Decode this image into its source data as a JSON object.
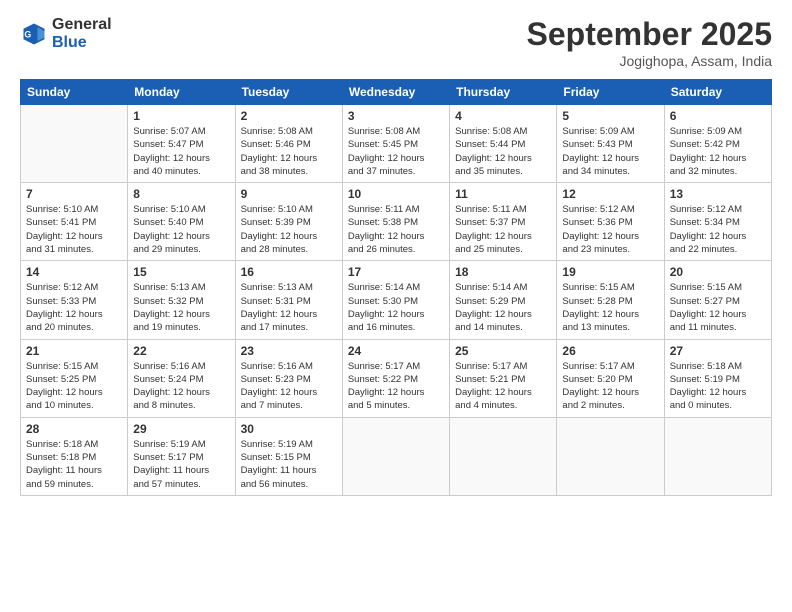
{
  "header": {
    "logo_line1": "General",
    "logo_line2": "Blue",
    "title": "September 2025",
    "location": "Jogighopa, Assam, India"
  },
  "days_of_week": [
    "Sunday",
    "Monday",
    "Tuesday",
    "Wednesday",
    "Thursday",
    "Friday",
    "Saturday"
  ],
  "weeks": [
    [
      {
        "day": "",
        "info": ""
      },
      {
        "day": "1",
        "info": "Sunrise: 5:07 AM\nSunset: 5:47 PM\nDaylight: 12 hours\nand 40 minutes."
      },
      {
        "day": "2",
        "info": "Sunrise: 5:08 AM\nSunset: 5:46 PM\nDaylight: 12 hours\nand 38 minutes."
      },
      {
        "day": "3",
        "info": "Sunrise: 5:08 AM\nSunset: 5:45 PM\nDaylight: 12 hours\nand 37 minutes."
      },
      {
        "day": "4",
        "info": "Sunrise: 5:08 AM\nSunset: 5:44 PM\nDaylight: 12 hours\nand 35 minutes."
      },
      {
        "day": "5",
        "info": "Sunrise: 5:09 AM\nSunset: 5:43 PM\nDaylight: 12 hours\nand 34 minutes."
      },
      {
        "day": "6",
        "info": "Sunrise: 5:09 AM\nSunset: 5:42 PM\nDaylight: 12 hours\nand 32 minutes."
      }
    ],
    [
      {
        "day": "7",
        "info": "Sunrise: 5:10 AM\nSunset: 5:41 PM\nDaylight: 12 hours\nand 31 minutes."
      },
      {
        "day": "8",
        "info": "Sunrise: 5:10 AM\nSunset: 5:40 PM\nDaylight: 12 hours\nand 29 minutes."
      },
      {
        "day": "9",
        "info": "Sunrise: 5:10 AM\nSunset: 5:39 PM\nDaylight: 12 hours\nand 28 minutes."
      },
      {
        "day": "10",
        "info": "Sunrise: 5:11 AM\nSunset: 5:38 PM\nDaylight: 12 hours\nand 26 minutes."
      },
      {
        "day": "11",
        "info": "Sunrise: 5:11 AM\nSunset: 5:37 PM\nDaylight: 12 hours\nand 25 minutes."
      },
      {
        "day": "12",
        "info": "Sunrise: 5:12 AM\nSunset: 5:36 PM\nDaylight: 12 hours\nand 23 minutes."
      },
      {
        "day": "13",
        "info": "Sunrise: 5:12 AM\nSunset: 5:34 PM\nDaylight: 12 hours\nand 22 minutes."
      }
    ],
    [
      {
        "day": "14",
        "info": "Sunrise: 5:12 AM\nSunset: 5:33 PM\nDaylight: 12 hours\nand 20 minutes."
      },
      {
        "day": "15",
        "info": "Sunrise: 5:13 AM\nSunset: 5:32 PM\nDaylight: 12 hours\nand 19 minutes."
      },
      {
        "day": "16",
        "info": "Sunrise: 5:13 AM\nSunset: 5:31 PM\nDaylight: 12 hours\nand 17 minutes."
      },
      {
        "day": "17",
        "info": "Sunrise: 5:14 AM\nSunset: 5:30 PM\nDaylight: 12 hours\nand 16 minutes."
      },
      {
        "day": "18",
        "info": "Sunrise: 5:14 AM\nSunset: 5:29 PM\nDaylight: 12 hours\nand 14 minutes."
      },
      {
        "day": "19",
        "info": "Sunrise: 5:15 AM\nSunset: 5:28 PM\nDaylight: 12 hours\nand 13 minutes."
      },
      {
        "day": "20",
        "info": "Sunrise: 5:15 AM\nSunset: 5:27 PM\nDaylight: 12 hours\nand 11 minutes."
      }
    ],
    [
      {
        "day": "21",
        "info": "Sunrise: 5:15 AM\nSunset: 5:25 PM\nDaylight: 12 hours\nand 10 minutes."
      },
      {
        "day": "22",
        "info": "Sunrise: 5:16 AM\nSunset: 5:24 PM\nDaylight: 12 hours\nand 8 minutes."
      },
      {
        "day": "23",
        "info": "Sunrise: 5:16 AM\nSunset: 5:23 PM\nDaylight: 12 hours\nand 7 minutes."
      },
      {
        "day": "24",
        "info": "Sunrise: 5:17 AM\nSunset: 5:22 PM\nDaylight: 12 hours\nand 5 minutes."
      },
      {
        "day": "25",
        "info": "Sunrise: 5:17 AM\nSunset: 5:21 PM\nDaylight: 12 hours\nand 4 minutes."
      },
      {
        "day": "26",
        "info": "Sunrise: 5:17 AM\nSunset: 5:20 PM\nDaylight: 12 hours\nand 2 minutes."
      },
      {
        "day": "27",
        "info": "Sunrise: 5:18 AM\nSunset: 5:19 PM\nDaylight: 12 hours\nand 0 minutes."
      }
    ],
    [
      {
        "day": "28",
        "info": "Sunrise: 5:18 AM\nSunset: 5:18 PM\nDaylight: 11 hours\nand 59 minutes."
      },
      {
        "day": "29",
        "info": "Sunrise: 5:19 AM\nSunset: 5:17 PM\nDaylight: 11 hours\nand 57 minutes."
      },
      {
        "day": "30",
        "info": "Sunrise: 5:19 AM\nSunset: 5:15 PM\nDaylight: 11 hours\nand 56 minutes."
      },
      {
        "day": "",
        "info": ""
      },
      {
        "day": "",
        "info": ""
      },
      {
        "day": "",
        "info": ""
      },
      {
        "day": "",
        "info": ""
      }
    ]
  ]
}
